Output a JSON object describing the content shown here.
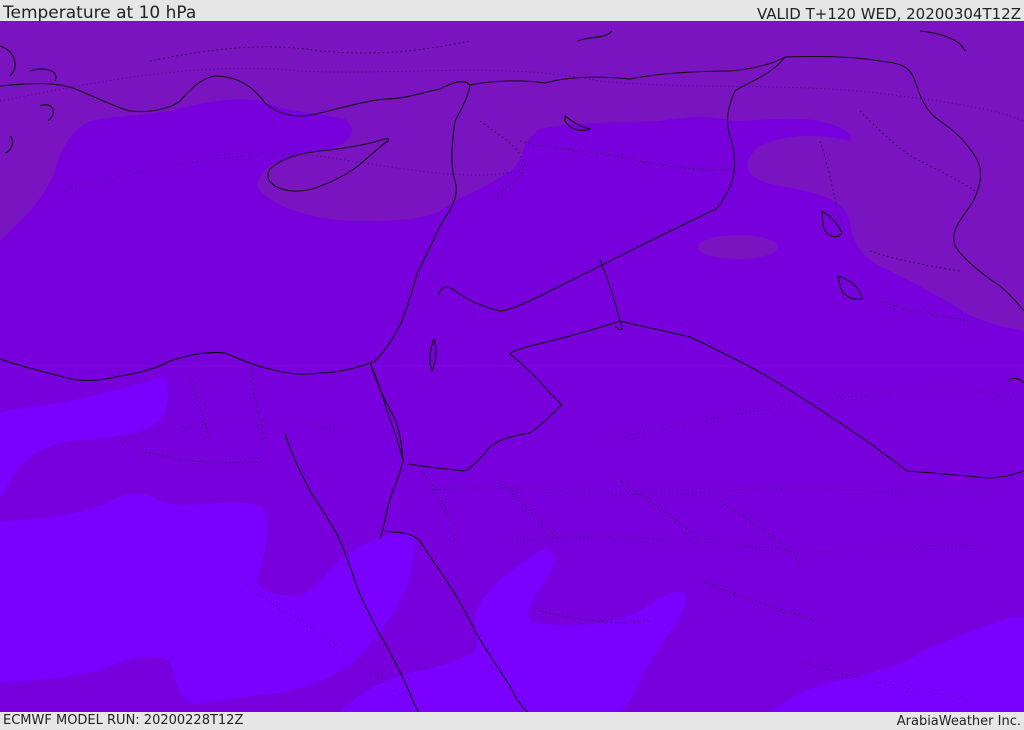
{
  "header": {
    "title": "Temperature at 10 hPa",
    "valid": "VALID T+120 WED, 20200304T12Z"
  },
  "footer": {
    "model_run": "ECMWF MODEL RUN: 20200228T12Z",
    "credit": "ArabiaWeather Inc."
  },
  "map": {
    "region": "Eastern Mediterranean and Middle East",
    "colors": {
      "north_band": "#7a14c0",
      "mid_band": "#7700dd",
      "south_band": "#7a00ff",
      "borders": "#111111",
      "contours": "#3a0066"
    }
  }
}
